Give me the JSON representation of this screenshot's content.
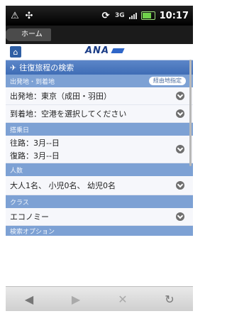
{
  "status": {
    "time": "10:17",
    "network": "3G"
  },
  "browser": {
    "back_tab_label": "ホーム"
  },
  "header": {
    "logo_text": "ANA"
  },
  "page": {
    "title": "往復旅程の検索",
    "sections": [
      {
        "label": "出発地・到着地",
        "badge": "経由地指定"
      },
      {
        "label": "搭乗日"
      },
      {
        "label": "人数"
      },
      {
        "label": "クラス"
      },
      {
        "label": "検索オプション"
      }
    ],
    "rows": {
      "departure": "出発地：東京（成田・羽田）",
      "arrival": "到着地：空港を選択してください",
      "outbound": "往路：3月--日",
      "return": "復路：3月--日",
      "passengers": "大人1名、 小児0名、 幼児0名",
      "class": "エコノミー"
    }
  },
  "nav": {
    "back": "◀",
    "forward": "▶",
    "stop": "✕",
    "reload": "↻"
  }
}
